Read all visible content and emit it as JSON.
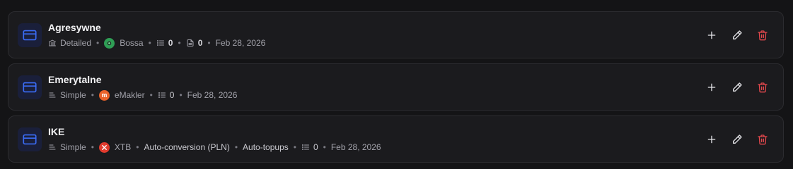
{
  "accounts": [
    {
      "name": "Agresywne",
      "mode": "Detailed",
      "mode_icon": "bank-icon",
      "broker": "Bossa",
      "broker_color": "#2f9e55",
      "positions": "0",
      "documents": "0",
      "date": "Feb 28, 2026"
    },
    {
      "name": "Emerytalne",
      "mode": "Simple",
      "mode_icon": "align-left-icon",
      "broker": "eMakler",
      "broker_color": "#e8622a",
      "positions": "0",
      "date": "Feb 28, 2026"
    },
    {
      "name": "IKE",
      "mode": "Simple",
      "mode_icon": "align-left-icon",
      "broker": "XTB",
      "broker_color": "#e23b2e",
      "feature_1": "Auto-conversion (PLN)",
      "feature_2": "Auto-topups",
      "positions": "0",
      "date": "Feb 28, 2026"
    }
  ],
  "colors": {
    "accent_blue": "#3b6cf6",
    "danger": "#e5484d"
  }
}
